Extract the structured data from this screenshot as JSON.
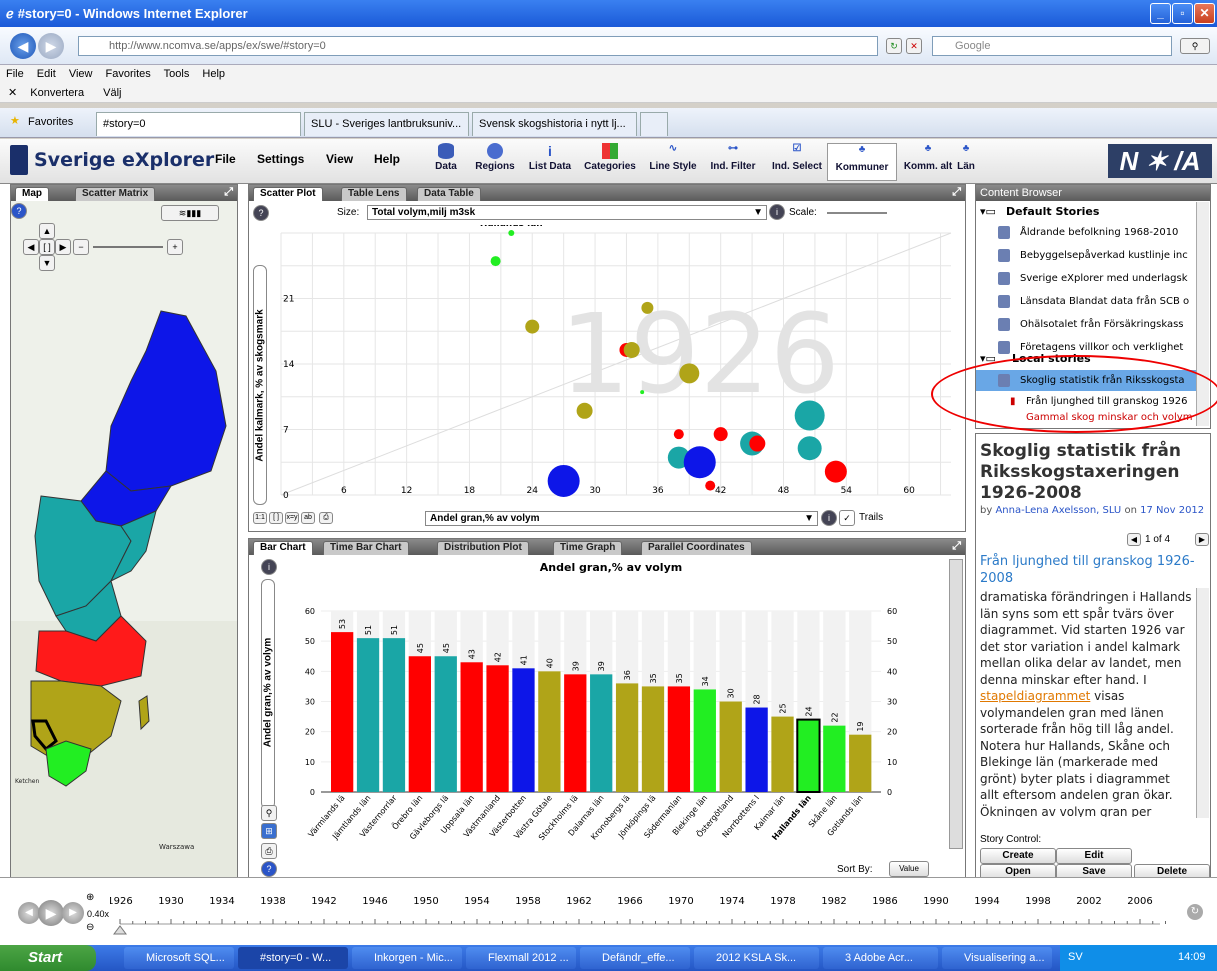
{
  "window": {
    "title": "#story=0 - Windows Internet Explorer",
    "url": "http://www.ncomva.se/apps/ex/swe/#story=0",
    "search_placeholder": "Google"
  },
  "ie_menu": [
    "File",
    "Edit",
    "View",
    "Favorites",
    "Tools",
    "Help"
  ],
  "ie_cmd": {
    "convert": "Konvertera",
    "select": "Välj"
  },
  "favorites": "Favorites",
  "ie_tabs": [
    "#story=0",
    "SLU - Sveriges lantbruksuniv...",
    "Svensk skogshistoria i nytt lj..."
  ],
  "app": {
    "brand": "Sverige eXplorer",
    "menu": [
      "File",
      "Settings",
      "View",
      "Help"
    ],
    "toolbar": [
      "Data",
      "Regions",
      "List Data",
      "Categories",
      "Line Style",
      "Ind. Filter",
      "Ind. Select",
      "Kommuner",
      "Komm. alt",
      "Län"
    ]
  },
  "map_panel": {
    "tabs": [
      "Map",
      "Scatter Matrix"
    ],
    "city_labels": [
      "Warszawa",
      "Ketchen"
    ]
  },
  "scatter": {
    "tabs": [
      "Scatter Plot",
      "Table Lens",
      "Data Table"
    ],
    "size_label": "Size:",
    "size_value": "Total volym,milj m3sk",
    "scale_label": "Scale:",
    "y_label": "Andel kalmark, % av skogsmark",
    "x_value": "Andel gran,% av volym",
    "trails": "Trails",
    "year_watermark": "1926",
    "highlight_label": "Hallands län",
    "xticks": [
      "6",
      "12",
      "18",
      "24",
      "30",
      "36",
      "42",
      "48",
      "54",
      "60"
    ],
    "yticks": [
      "21",
      "14",
      "7",
      "0"
    ]
  },
  "bar": {
    "tabs": [
      "Bar Chart",
      "Time Bar Chart",
      "Distribution Plot",
      "Time Graph",
      "Parallel Coordinates"
    ],
    "sort_by": "Sort By:",
    "sort_value": "Value",
    "y_label": "Andel gran,% av volym"
  },
  "content_browser": {
    "title": "Content Browser",
    "default_group": "Default Stories",
    "default_stories": [
      "Åldrande befolkning 1968-2010",
      "Bebyggelsepåverkad kustlinje inc",
      "Sverige eXplorer med underlagsk",
      "Länsdata Blandat data från SCB o",
      "Ohälsotalet från Försäkringskass",
      "Företagens villkor och verklighet"
    ],
    "local_group": "Local stories",
    "local_story": "Skoglig statistik från Riksskogsta",
    "local_chapters": [
      "Från ljunghed till granskog 1926",
      "Gammal skog minskar och volym"
    ]
  },
  "story_view": {
    "title": "Skoglig statistik från Riksskogstaxeringen 1926-2008",
    "byline_pre": "by",
    "author": "Anna-Lena Axelsson, SLU",
    "byline_on": "on",
    "date": "17 Nov 2012",
    "page": "1 of 4",
    "chapter": "Från ljunghed till granskog 1926-2008",
    "body_1": "dramatiska förändringen i Hallands län syns som ett spår tvärs över diagrammet. Vid starten 1926 var det stor variation i andel kalmark mellan olika delar av landet, men denna minskar efter hand. I ",
    "link": "stapeldiagrammet",
    "body_2": " visas volymandelen gran med länen sorterade från hög till låg andel. Notera hur Hallands, Skåne och Blekinge län (markerade med grönt) byter plats i diagrammet allt eftersom andelen gran ökar. Ökningen av volym gran per hektar under perioden 1955-2008 visas i"
  },
  "story_control": {
    "label": "Story Control:",
    "buttons": [
      "Create",
      "Edit",
      "Open",
      "Save",
      "Delete"
    ]
  },
  "timeline": {
    "speed": "0.40x",
    "years": [
      "1926",
      "1930",
      "1934",
      "1938",
      "1942",
      "1946",
      "1950",
      "1954",
      "1958",
      "1962",
      "1966",
      "1970",
      "1974",
      "1978",
      "1982",
      "1986",
      "1990",
      "1994",
      "1998",
      "2002",
      "2006"
    ]
  },
  "taskbar": {
    "start": "Start",
    "tasks": [
      "Microsoft SQL...",
      "#story=0 - W...",
      "Inkorgen - Mic...",
      "Flexmall 2012 ...",
      "Defändr_effe...",
      "2012 KSLA Sk...",
      "3 Adobe Acr...",
      "Visualisering a..."
    ],
    "lang": "SV",
    "clock": "14:09"
  },
  "colors": {
    "red": "#ff0000",
    "teal": "#1aa6a6",
    "blue": "#0d16e8",
    "olive": "#b0a418",
    "green": "#22ee22"
  },
  "chart_data": [
    {
      "type": "bar",
      "title": "Andel gran,% av volym",
      "ylabel": "Andel gran,% av volym",
      "ylim": [
        0,
        60
      ],
      "yticks": [
        0,
        10,
        20,
        30,
        40,
        50,
        60
      ],
      "categories": [
        "Värmlands lä",
        "Jämtlands län",
        "Västernorrlar",
        "Örebro län",
        "Gävleborgs lä",
        "Uppsala län",
        "Västmanland",
        "Västerbotten",
        "Västra Götale",
        "Stockholms lä",
        "Dalarnas län",
        "Kronobergs lä",
        "Jönköpings lä",
        "Södermanlan",
        "Blekinge län",
        "Östergötland",
        "Norrbottens l",
        "Kalmar län",
        "Hallands län",
        "Skåne län",
        "Gotlands län"
      ],
      "values": [
        53,
        51,
        51,
        45,
        45,
        43,
        42,
        41,
        40,
        39,
        39,
        36,
        35,
        35,
        34,
        30,
        28,
        25,
        24,
        22,
        19
      ],
      "bar_colors": [
        "red",
        "teal",
        "teal",
        "red",
        "teal",
        "red",
        "red",
        "blue",
        "olive",
        "red",
        "teal",
        "olive",
        "olive",
        "red",
        "green",
        "olive",
        "blue",
        "olive",
        "green",
        "green",
        "olive"
      ],
      "highlight": "Hallands län"
    },
    {
      "type": "scatter",
      "xlabel": "Andel gran,% av volym",
      "ylabel": "Andel kalmark, % av skogsmark",
      "xlim": [
        0,
        64
      ],
      "ylim": [
        0,
        28
      ],
      "points": [
        {
          "x": 22,
          "y": 28,
          "s": 3,
          "c": "green",
          "label": "Hallands län"
        },
        {
          "x": 20.5,
          "y": 25,
          "s": 5,
          "c": "green"
        },
        {
          "x": 24,
          "y": 18,
          "s": 7,
          "c": "olive"
        },
        {
          "x": 35,
          "y": 20,
          "s": 6,
          "c": "olive"
        },
        {
          "x": 33,
          "y": 15.5,
          "s": 7,
          "c": "red"
        },
        {
          "x": 33.5,
          "y": 15.5,
          "s": 8,
          "c": "olive"
        },
        {
          "x": 39,
          "y": 13,
          "s": 10,
          "c": "olive"
        },
        {
          "x": 34.5,
          "y": 11,
          "s": 2,
          "c": "green"
        },
        {
          "x": 29,
          "y": 9,
          "s": 8,
          "c": "olive"
        },
        {
          "x": 38,
          "y": 6.5,
          "s": 5,
          "c": "red"
        },
        {
          "x": 38,
          "y": 4,
          "s": 11,
          "c": "teal"
        },
        {
          "x": 40,
          "y": 3.5,
          "s": 16,
          "c": "blue"
        },
        {
          "x": 41,
          "y": 1,
          "s": 5,
          "c": "red"
        },
        {
          "x": 42,
          "y": 6.5,
          "s": 7,
          "c": "red"
        },
        {
          "x": 45,
          "y": 5.5,
          "s": 12,
          "c": "teal"
        },
        {
          "x": 45.5,
          "y": 5.5,
          "s": 8,
          "c": "red"
        },
        {
          "x": 50.5,
          "y": 8.5,
          "s": 15,
          "c": "teal"
        },
        {
          "x": 50.5,
          "y": 5,
          "s": 12,
          "c": "teal"
        },
        {
          "x": 53,
          "y": 2.5,
          "s": 11,
          "c": "red"
        },
        {
          "x": 27,
          "y": 1.5,
          "s": 16,
          "c": "blue"
        }
      ]
    }
  ]
}
